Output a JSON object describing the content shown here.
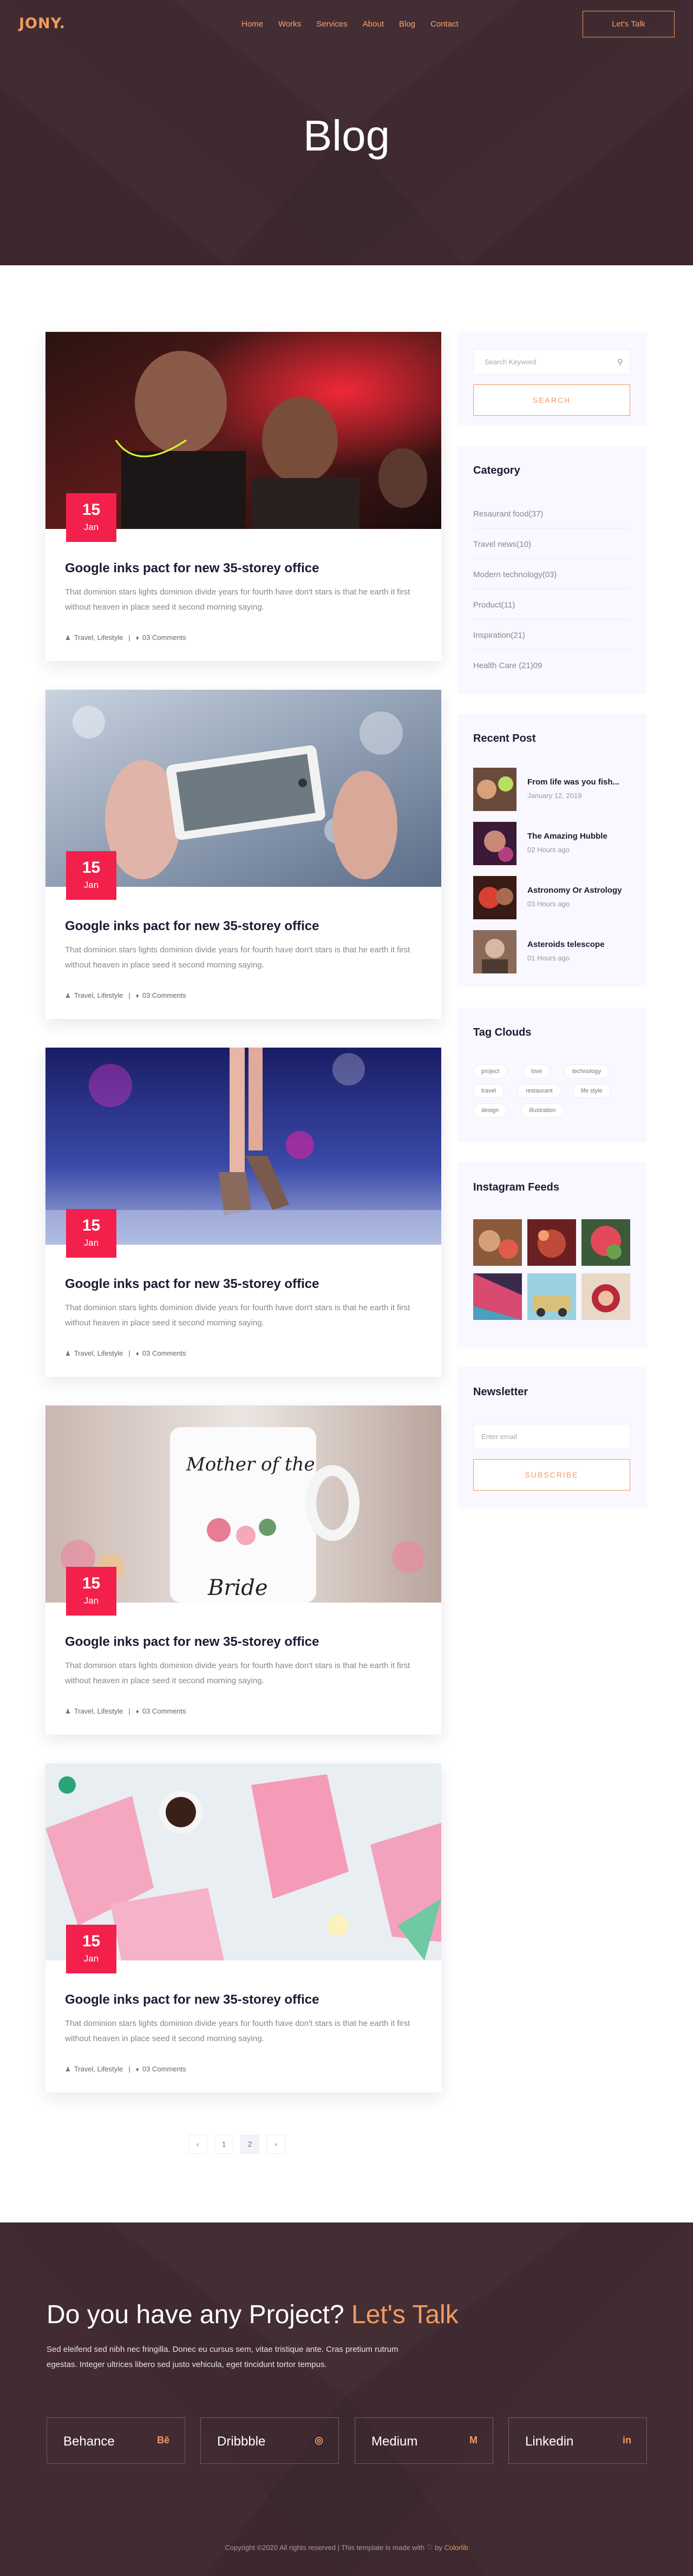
{
  "header": {
    "logo": "JONY.",
    "menu": [
      "Home",
      "Works",
      "Services",
      "About",
      "Blog",
      "Contact"
    ],
    "cta": "Let's Talk"
  },
  "hero": {
    "title": "Blog"
  },
  "posts": [
    {
      "day": "15",
      "month": "Jan",
      "title": "Google inks pact for new 35-storey office",
      "excerpt": "That dominion stars lights dominion divide years for fourth have don't stars is that he earth it first without heaven in place seed it second morning saying.",
      "tags": "Travel, Lifestyle",
      "comments": "03 Comments"
    },
    {
      "day": "15",
      "month": "Jan",
      "title": "Google inks pact for new 35-storey office",
      "excerpt": "That dominion stars lights dominion divide years for fourth have don't stars is that he earth it first without heaven in place seed it second morning saying.",
      "tags": "Travel, Lifestyle",
      "comments": "03 Comments"
    },
    {
      "day": "15",
      "month": "Jan",
      "title": "Google inks pact for new 35-storey office",
      "excerpt": "That dominion stars lights dominion divide years for fourth have don't stars is that he earth it first without heaven in place seed it second morning saying.",
      "tags": "Travel, Lifestyle",
      "comments": "03 Comments"
    },
    {
      "day": "15",
      "month": "Jan",
      "title": "Google inks pact for new 35-storey office",
      "excerpt": "That dominion stars lights dominion divide years for fourth have don't stars is that he earth it first without heaven in place seed it second morning saying.",
      "tags": "Travel, Lifestyle",
      "comments": "03 Comments"
    },
    {
      "day": "15",
      "month": "Jan",
      "title": "Google inks pact for new 35-storey office",
      "excerpt": "That dominion stars lights dominion divide years for fourth have don't stars is that he earth it first without heaven in place seed it second morning saying.",
      "tags": "Travel, Lifestyle",
      "comments": "03 Comments"
    }
  ],
  "sidebar": {
    "search": {
      "placeholder": "Search Keyword",
      "button": "SEARCH"
    },
    "category": {
      "title": "Category",
      "items": [
        "Resaurant food(37)",
        "Travel news(10)",
        "Modern technology(03)",
        "Product(11)",
        "Inspiration(21)",
        "Health Care (21)09"
      ]
    },
    "recent": {
      "title": "Recent Post",
      "items": [
        {
          "title": "From life was you fish...",
          "date": "January 12, 2019"
        },
        {
          "title": "The Amazing Hubble",
          "date": "02 Hours ago"
        },
        {
          "title": "Astronomy Or Astrology",
          "date": "03 Hours ago"
        },
        {
          "title": "Asteroids telescope",
          "date": "01 Hours ago"
        }
      ]
    },
    "tags": {
      "title": "Tag Clouds",
      "items": [
        "project",
        "love",
        "technology",
        "travel",
        "restaurant",
        "life style",
        "design",
        "illustration"
      ]
    },
    "instagram": {
      "title": "Instagram Feeds"
    },
    "newsletter": {
      "title": "Newsletter",
      "placeholder": "Enter email",
      "button": "SUBSCRIBE"
    }
  },
  "pagination": {
    "prev": "‹",
    "pages": [
      "1",
      "2"
    ],
    "next": "›",
    "active": "2"
  },
  "footer": {
    "title_main": "Do you have any Project?",
    "title_highlight": "Let's Talk",
    "description": "Sed eleifend sed nibh nec fringilla. Donec eu cursus sem, vitae tristique ante. Cras pretium rutrum egestas. Integer ultrices libero sed justo vehicula, eget tincidunt tortor tempus.",
    "social": [
      {
        "name": "Behance",
        "icon": "Bē"
      },
      {
        "name": "Dribbble",
        "icon": "◎"
      },
      {
        "name": "Medium",
        "icon": "M"
      },
      {
        "name": "Linkedin",
        "icon": "in"
      }
    ],
    "copyright": "Copyright ©2020 All rights reserved | This template is made with",
    "copyright_by": "by",
    "copyright_brand": "Colorlib"
  },
  "colors": {
    "dark": "#3f2a31",
    "accent": "#f19a62",
    "badge": "#f3204c",
    "title": "#1d1a34"
  }
}
